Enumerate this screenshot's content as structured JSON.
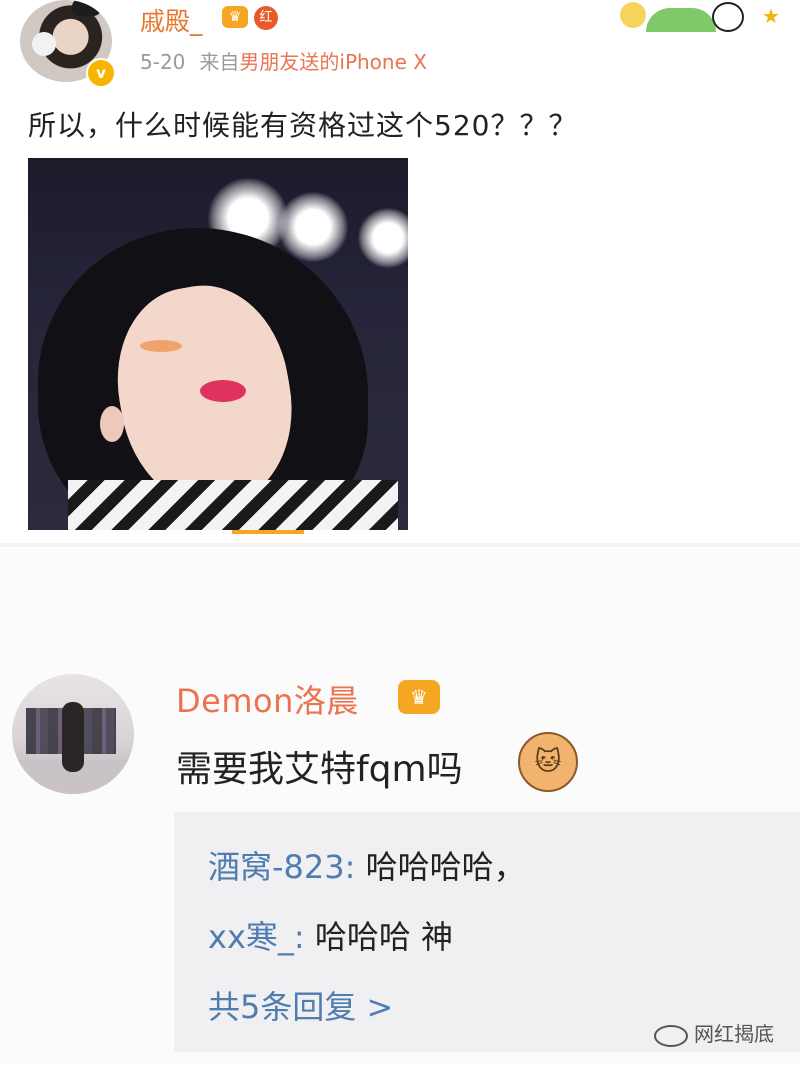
{
  "post": {
    "username": "戚殿_",
    "crown_badge": "♛",
    "hong_badge": "红",
    "verified_badge": "v",
    "date": "5-20",
    "source_prefix": "来自",
    "source": "男朋友送的iPhone X",
    "text": "所以，什么时候能有资格过这个520？？？"
  },
  "comment": {
    "username": "Demon洛晨",
    "crown_badge": "♛",
    "text": "需要我艾特fqm吗",
    "emoji": "🐱",
    "replies": [
      {
        "name": "酒窝-823:",
        "text": " 哈哈哈哈，"
      },
      {
        "name": "xx寒_:",
        "text": " 哈哈哈 神"
      }
    ],
    "more_replies": "共5条回复 >"
  },
  "watermark": "网红揭底"
}
